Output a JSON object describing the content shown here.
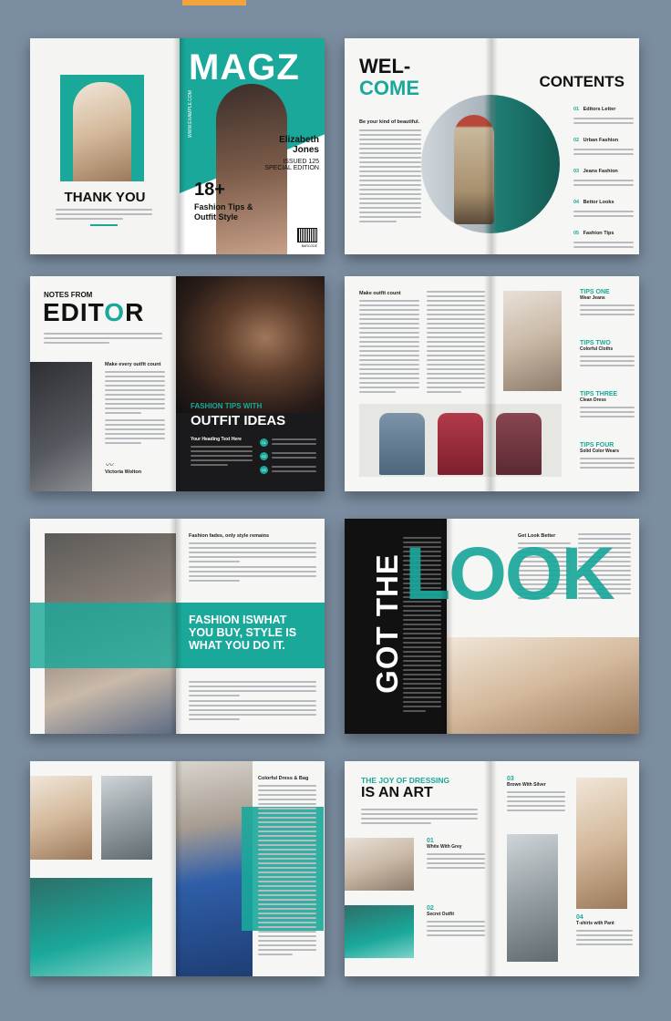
{
  "spread1": {
    "thank_you": "THANK YOU",
    "cover_brand": "MAGZ",
    "cover_site": "WWW.EXAMPLE.COM",
    "cover_name_line1": "Elizabeth",
    "cover_name_line2": "Jones",
    "cover_issue": "ISSUED 125",
    "cover_edition": "SPECIAL EDITION",
    "cover_count": "18+",
    "cover_tips_line1": "Fashion Tips &",
    "cover_tips_line2": "Outfit Style",
    "barcode_label": "BARCODE"
  },
  "spread2": {
    "welcome_line1": "WEL-",
    "welcome_line2": "COME",
    "kind": "Be your kind of beautiful.",
    "contents_title": "CONTENTS",
    "contents": [
      {
        "num": "01",
        "label": "Editors Letter"
      },
      {
        "num": "02",
        "label": "Urban Fashion"
      },
      {
        "num": "03",
        "label": "Jeans Fashion"
      },
      {
        "num": "04",
        "label": "Bettor Looks"
      },
      {
        "num": "05",
        "label": "Fashion Tips"
      }
    ]
  },
  "spread3": {
    "notes_from": "NOTES FROM",
    "editor_pre": "EDIT",
    "editor_o": "O",
    "editor_post": "R",
    "make_outfit": "Make every outfit count",
    "signature_name": "Victoria Wolton",
    "fashion_tips_with": "FASHION TIPS WITH",
    "outfit_ideas": "OUTFIT IDEAS",
    "heading_text": "Your Heading Text Here",
    "list_nums": [
      "01",
      "02",
      "03"
    ]
  },
  "spread4": {
    "make_outfit": "Make outfit count",
    "tips": [
      {
        "title": "TIPS ONE",
        "sub": "Wear Jeans"
      },
      {
        "title": "TIPS TWO",
        "sub": "Colorful Cloths"
      },
      {
        "title": "TIPS THREE",
        "sub": "Clean Dress"
      },
      {
        "title": "TIPS FOUR",
        "sub": "Solid Color Wears"
      }
    ]
  },
  "spread5": {
    "heading": "Fashion fades, only style remains",
    "quote_line1": "FASHION ISWHAT",
    "quote_line2": "YOU BUY, STYLE IS",
    "quote_line3": "WHAT YOU DO IT."
  },
  "spread6": {
    "got_the": "GOT THE",
    "look": "LOOK",
    "get_look_better": "Get Look Better"
  },
  "spread7": {
    "heading": "Colorful Dress & Bag"
  },
  "spread8": {
    "joy": "THE JOY OF DRESSING",
    "art": "IS AN ART",
    "items": [
      {
        "num": "01",
        "label": "White With Grey"
      },
      {
        "num": "02",
        "label": "Secret Outfit"
      },
      {
        "num": "03",
        "label": "Brown With Silver"
      },
      {
        "num": "04",
        "label": "T-shirts with Pant"
      }
    ]
  },
  "colors": {
    "accent": "#1aa89a",
    "background": "#7b8da0",
    "tab": "#f2a33a"
  }
}
